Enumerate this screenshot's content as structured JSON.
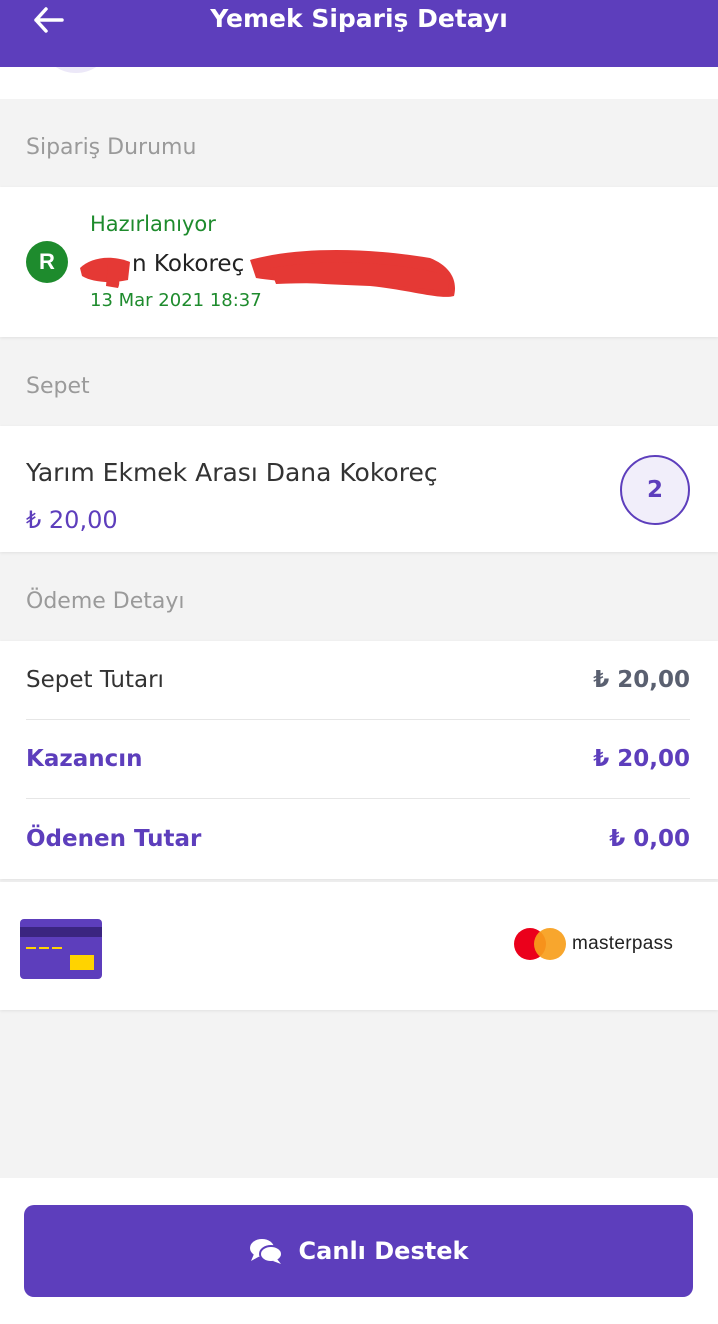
{
  "header": {
    "title": "Yemek Sipariş Detayı",
    "back_icon": "arrow-left-icon"
  },
  "sections": {
    "status_label": "Sipariş Durumu",
    "basket_label": "Sepet",
    "payment_label": "Ödeme Detayı"
  },
  "order_status": {
    "status": "Hazırlanıyor",
    "badge_letter": "R",
    "restaurant_name_visible": "n Kokoreç",
    "date": "13 Mar 2021 18:37"
  },
  "basket": {
    "items": [
      {
        "name": "Yarım Ekmek Arası Dana Kokoreç",
        "price": "₺ 20,00",
        "quantity": "2"
      }
    ]
  },
  "payment": {
    "rows": [
      {
        "label": "Sepet Tutarı",
        "value": "₺ 20,00"
      },
      {
        "label": "Kazancın",
        "value": "₺ 20,00"
      },
      {
        "label": "Ödenen Tutar",
        "value": "₺ 0,00"
      }
    ],
    "method_brand": "masterpass"
  },
  "footer": {
    "support_label": "Canlı Destek",
    "support_icon": "chat-bubbles-icon"
  },
  "colors": {
    "brand": "#5d3ebc",
    "status_green": "#1e8b2d",
    "masterpass_red": "#eb001b",
    "masterpass_orange": "#f79e1b",
    "card_chip_yellow": "#ffd300"
  }
}
